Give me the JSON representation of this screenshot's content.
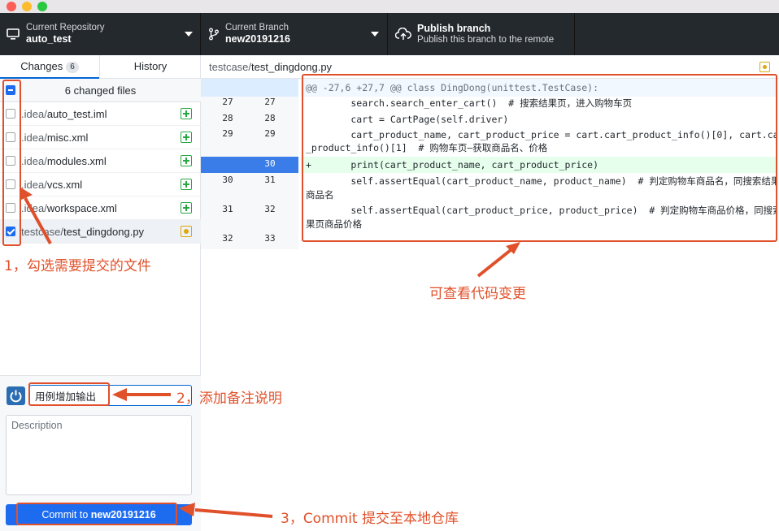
{
  "toolbar": {
    "repo": {
      "label": "Current Repository",
      "value": "auto_test"
    },
    "branch": {
      "label": "Current Branch",
      "value": "new20191216"
    },
    "publish": {
      "title": "Publish branch",
      "subtitle": "Publish this branch to the remote"
    }
  },
  "tabs": {
    "changes_label": "Changes",
    "changes_count": "6",
    "history_label": "History"
  },
  "changes": {
    "header": "6 changed files",
    "files": [
      {
        "dir": ".idea/",
        "name": "auto_test.iml",
        "status": "added",
        "checked": false
      },
      {
        "dir": ".idea/",
        "name": "misc.xml",
        "status": "added",
        "checked": false
      },
      {
        "dir": ".idea/",
        "name": "modules.xml",
        "status": "added",
        "checked": false
      },
      {
        "dir": ".idea/",
        "name": "vcs.xml",
        "status": "added",
        "checked": false
      },
      {
        "dir": ".idea/",
        "name": "workspace.xml",
        "status": "added",
        "checked": false
      },
      {
        "dir": "testcase/",
        "name": "test_dingdong.py",
        "status": "modified",
        "checked": true
      }
    ]
  },
  "commit": {
    "summary_value": "用例增加输出",
    "description_placeholder": "Description",
    "button_prefix": "Commit to ",
    "button_branch": "new20191216"
  },
  "diff": {
    "path_dir": "testcase/",
    "path_file": "test_dingdong.py",
    "hunk": "@@ -27,6 +27,7 @@ class DingDong(unittest.TestCase):",
    "rows": [
      {
        "old": "27",
        "new": "27",
        "text": "        search.search_enter_cart()  # 搜索结果页，进入购物车页"
      },
      {
        "old": "28",
        "new": "28",
        "text": "        cart = CartPage(self.driver)"
      },
      {
        "old": "29",
        "new": "29",
        "text": "        cart_product_name, cart_product_price = cart.cart_product_info()[0], cart.cart"
      },
      {
        "old": "",
        "new": "",
        "text": "_product_info()[1]  # 购物车页—获取商品名、价格"
      },
      {
        "old": "",
        "new": "30",
        "text": "+       print(cart_product_name, cart_product_price)",
        "added": true
      },
      {
        "old": "30",
        "new": "31",
        "text": "        self.assertEqual(cart_product_name, product_name)  # 判定购物车商品名，同搜索结果页"
      },
      {
        "old": "",
        "new": "",
        "text": "商品名"
      },
      {
        "old": "31",
        "new": "32",
        "text": "        self.assertEqual(cart_product_price, product_price)  # 判定购物车商品价格，同搜索结"
      },
      {
        "old": "",
        "new": "",
        "text": "果页商品价格"
      },
      {
        "old": "32",
        "new": "33",
        "text": ""
      }
    ]
  },
  "annotations": {
    "step1": "1，勾选需要提交的文件",
    "view": "可查看代码变更",
    "step2": "2，添加备注说明",
    "step3": "3，Commit 提交至本地仓库"
  },
  "colors": {
    "accent": "#1d6cf0",
    "annotation": "#e0502a",
    "toolbar": "#24292e",
    "added": "#28a745",
    "modified": "#dba90f"
  }
}
